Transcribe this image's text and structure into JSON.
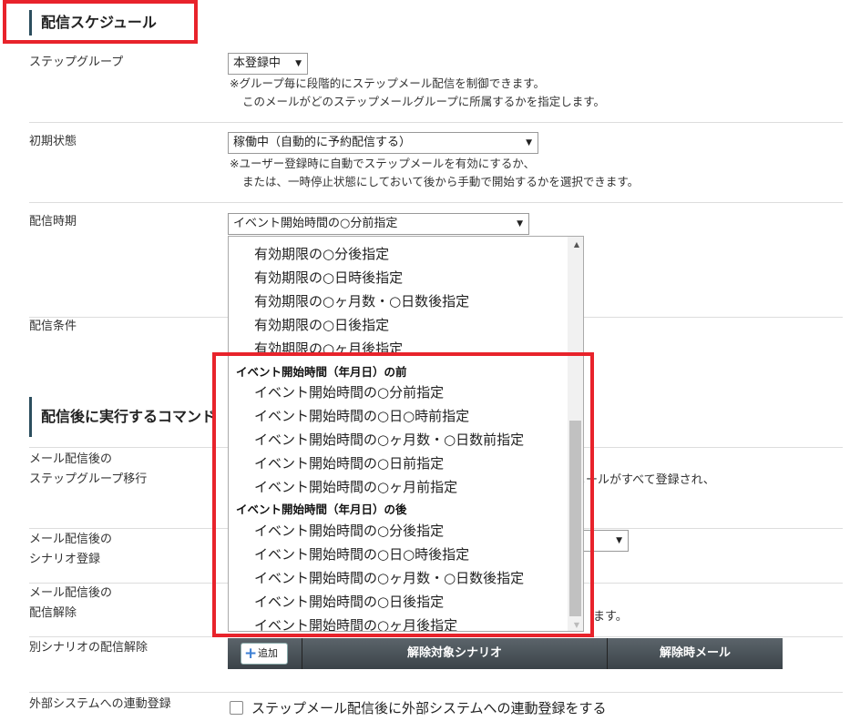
{
  "section1": {
    "title": "配信スケジュール"
  },
  "step_group": {
    "label": "ステップグループ",
    "value": "本登録中",
    "note1": "※グループ毎に段階的にステップメール配信を制御できます。",
    "note2": "このメールがどのステップメールグループに所属するかを指定します。"
  },
  "initial_state": {
    "label": "初期状態",
    "value": "稼働中（自動的に予約配信する）",
    "note1": "※ユーザー登録時に自動でステップメールを有効にするか、",
    "note2": "または、一時停止状態にしておいて後から手動で開始するかを選択できます。"
  },
  "timing": {
    "label": "配信時期",
    "value": "イベント開始時間の○分前指定",
    "options": [
      "有効期限の○分後指定",
      "有効期限の○日時後指定",
      "有効期限の○ヶ月数・○日数後指定",
      "有効期限の○日後指定",
      "有効期限の○ヶ月後指定"
    ],
    "group_before": "イベント開始時間（年月日）の前",
    "before_options": [
      "イベント開始時間の○分前指定",
      "イベント開始時間の○日○時前指定",
      "イベント開始時間の○ヶ月数・○日数前指定",
      "イベント開始時間の○日前指定",
      "イベント開始時間の○ヶ月前指定"
    ],
    "group_after": "イベント開始時間（年月日）の後",
    "after_options": [
      "イベント開始時間の○分後指定",
      "イベント開始時間の○日○時後指定",
      "イベント開始時間の○ヶ月数・○日数後指定",
      "イベント開始時間の○日後指定",
      "イベント開始時間の○ヶ月後指定"
    ]
  },
  "condition": {
    "label": "配信条件"
  },
  "section2": {
    "title": "配信後に実行するコマンド"
  },
  "migrate": {
    "label1": "メール配信後の",
    "label2": "ステップグループ移行",
    "note_partial": "メールがすべて登録され、"
  },
  "scenario_reg": {
    "label1": "メール配信後の",
    "label2": "シナリオ登録"
  },
  "unsubscribe": {
    "label1": "メール配信後の",
    "label2": "配信解除",
    "note_partial": "ます。"
  },
  "other_unsub": {
    "label": "別シナリオの配信解除",
    "add_label": "追加",
    "col_scenario": "解除対象シナリオ",
    "col_mail": "解除時メール"
  },
  "external": {
    "label": "外部システムへの連動登録",
    "checkbox_label": "ステップメール配信後に外部システムへの連動登録をする"
  },
  "colors": {
    "highlight": "#e8232b",
    "accent": "#2c4e5e",
    "add_icon": "#3b7fd4"
  }
}
